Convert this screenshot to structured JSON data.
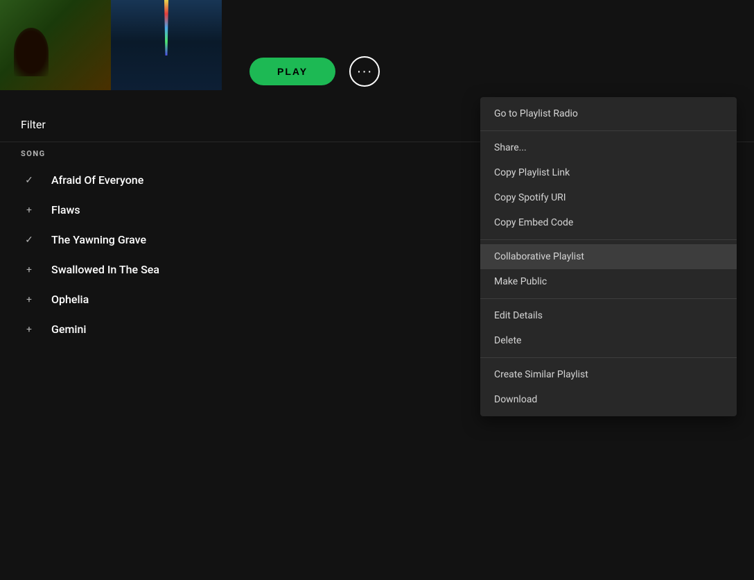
{
  "header": {
    "play_label": "PLAY",
    "more_dots": "•••"
  },
  "filter": {
    "label": "Filter"
  },
  "song_list": {
    "column_header": "SONG",
    "songs": [
      {
        "title": "Afraid Of Everyone",
        "icon": "check"
      },
      {
        "title": "Flaws",
        "icon": "plus"
      },
      {
        "title": "The Yawning Grave",
        "icon": "check"
      },
      {
        "title": "Swallowed In The Sea",
        "icon": "plus"
      },
      {
        "title": "Ophelia",
        "icon": "plus"
      },
      {
        "title": "Gemini",
        "icon": "plus"
      }
    ]
  },
  "context_menu": {
    "sections": [
      {
        "items": [
          {
            "label": "Go to Playlist Radio"
          }
        ]
      },
      {
        "items": [
          {
            "label": "Share..."
          },
          {
            "label": "Copy Playlist Link"
          },
          {
            "label": "Copy Spotify URI"
          },
          {
            "label": "Copy Embed Code"
          }
        ]
      },
      {
        "items": [
          {
            "label": "Collaborative Playlist"
          },
          {
            "label": "Make Public"
          }
        ]
      },
      {
        "items": [
          {
            "label": "Edit Details"
          },
          {
            "label": "Delete"
          }
        ]
      },
      {
        "items": [
          {
            "label": "Create Similar Playlist"
          },
          {
            "label": "Download"
          }
        ]
      }
    ]
  }
}
